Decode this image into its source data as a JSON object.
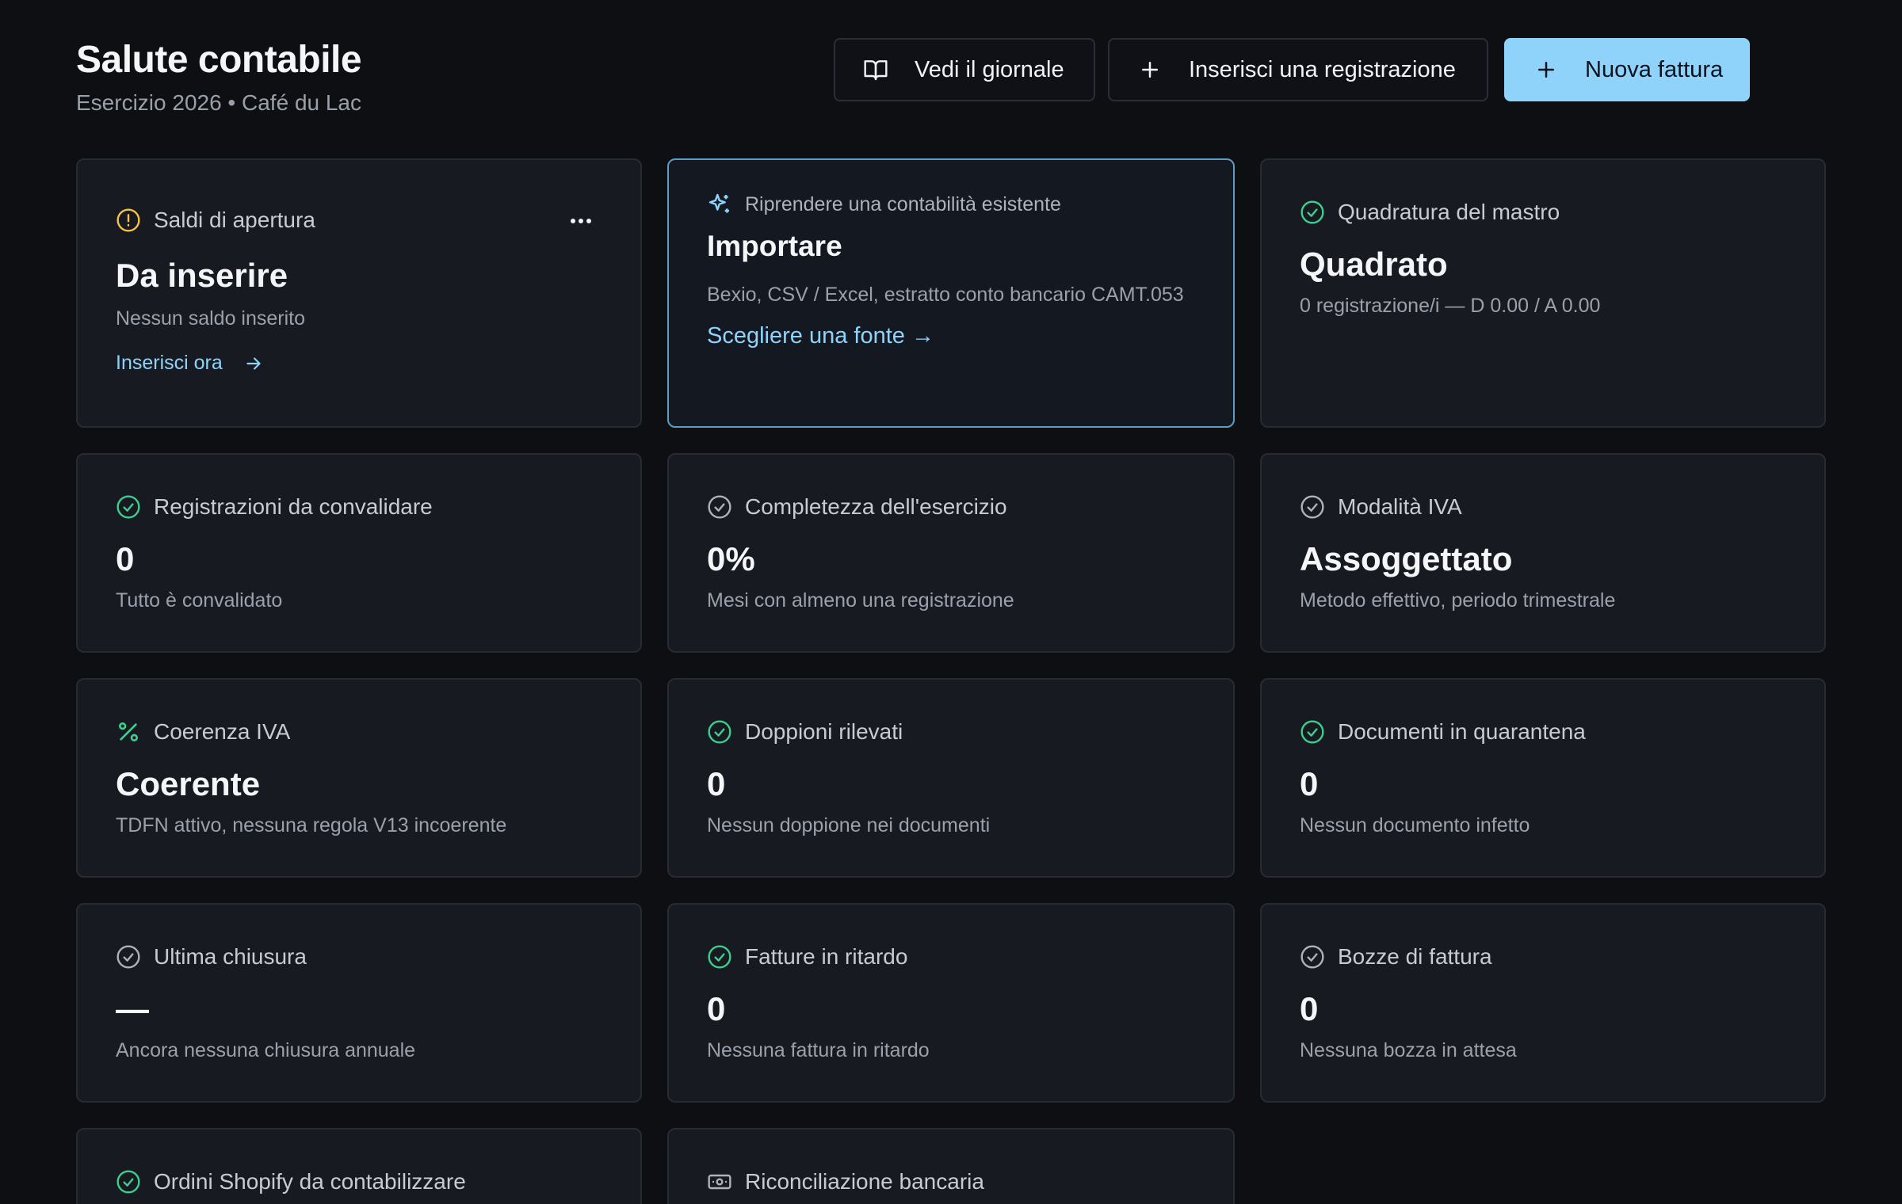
{
  "header": {
    "title": "Salute contabile",
    "subtitle": "Esercizio 2026 • Café du Lac",
    "buttons": {
      "journal": "Vedi il giornale",
      "entry": "Inserisci una registrazione",
      "invoice": "Nuova fattura"
    }
  },
  "colors": {
    "accent": "#8fd3fb",
    "success": "#3ecf8e",
    "warning": "#f5c542",
    "muted_icon": "#9aa0aa"
  },
  "cards": {
    "opening": {
      "icon": "alert-circle-icon",
      "label": "Saldi di apertura",
      "value": "Da inserire",
      "desc": "Nessun saldo inserito",
      "link": "Inserisci ora"
    },
    "import": {
      "icon": "sparkles-icon",
      "label": "Riprendere una contabilità esistente",
      "value": "Importare",
      "desc": "Bexio, CSV / Excel, estratto conto bancario CAMT.053",
      "link": "Scegliere una fonte →"
    },
    "ledger": {
      "icon": "check-circle-icon",
      "label": "Quadratura del mastro",
      "value": "Quadrato",
      "desc": "0 registrazione/i — D 0.00 / A 0.00"
    },
    "to_validate": {
      "icon": "check-circle-icon",
      "label": "Registrazioni da convalidare",
      "value": "0",
      "desc": "Tutto è convalidato"
    },
    "completeness": {
      "icon": "check-circle-icon",
      "label": "Completezza dell'esercizio",
      "value": "0%",
      "desc": "Mesi con almeno una registrazione"
    },
    "vat_mode": {
      "icon": "check-circle-icon",
      "label": "Modalità IVA",
      "value": "Assoggettato",
      "desc": "Metodo effettivo, periodo trimestrale"
    },
    "vat_coherence": {
      "icon": "percent-icon",
      "label": "Coerenza IVA",
      "value": "Coerente",
      "desc": "TDFN attivo, nessuna regola V13 incoerente"
    },
    "duplicates": {
      "icon": "check-circle-icon",
      "label": "Doppioni rilevati",
      "value": "0",
      "desc": "Nessun doppione nei documenti"
    },
    "quarantine": {
      "icon": "check-circle-icon",
      "label": "Documenti in quarantena",
      "value": "0",
      "desc": "Nessun documento infetto"
    },
    "last_closing": {
      "icon": "check-circle-icon",
      "label": "Ultima chiusura",
      "value": "—",
      "desc": "Ancora nessuna chiusura annuale"
    },
    "late_invoices": {
      "icon": "check-circle-icon",
      "label": "Fatture in ritardo",
      "value": "0",
      "desc": "Nessuna fattura in ritardo"
    },
    "draft_invoices": {
      "icon": "check-circle-icon",
      "label": "Bozze di fattura",
      "value": "0",
      "desc": "Nessuna bozza in attesa"
    },
    "shopify": {
      "icon": "check-circle-icon",
      "label": "Ordini Shopify da contabilizzare"
    },
    "bank_rec": {
      "icon": "banknote-icon",
      "label": "Riconciliazione bancaria"
    }
  }
}
